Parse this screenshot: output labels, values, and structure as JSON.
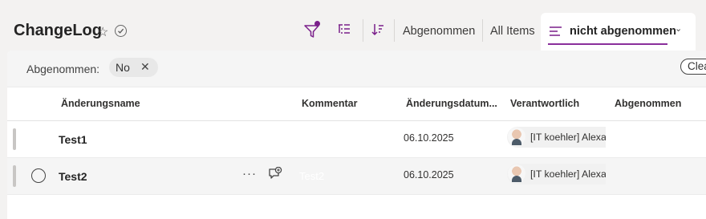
{
  "header": {
    "title": "ChangeLog",
    "star_glyph": "☆",
    "views": [
      "Abgenommen",
      "All Items"
    ],
    "active_view": "nicht abgenommen",
    "active_view_chevron": "⌄"
  },
  "filterbar": {
    "label": "Abgenommen:",
    "chip_value": "No",
    "chip_remove": "✕",
    "clear_label": "Clea"
  },
  "columns": [
    "Änderungsname",
    "Kommentar",
    "Änderungsdatum...",
    "Verantwortlich",
    "Abgenommen"
  ],
  "rows": [
    {
      "name": "Test1",
      "comment": "",
      "date": "06.10.2025",
      "responsible": "[IT koehler] Alexan",
      "abgenommen": ""
    },
    {
      "name": "Test2",
      "comment": "Test2",
      "date": "06.10.2025",
      "responsible": "[IT koehler] Alexan",
      "abgenommen": ""
    }
  ],
  "row_more_glyph": "···",
  "colors": {
    "accent": "#8a2f9b",
    "filter_dot": "#7a1f8a"
  },
  "icons": [
    "star-icon",
    "circle-check-icon",
    "filter-icon",
    "group-list-icon",
    "sort-icon",
    "view-lines-icon",
    "chevron-down-icon",
    "close-icon",
    "more-icon",
    "add-comment-icon"
  ]
}
